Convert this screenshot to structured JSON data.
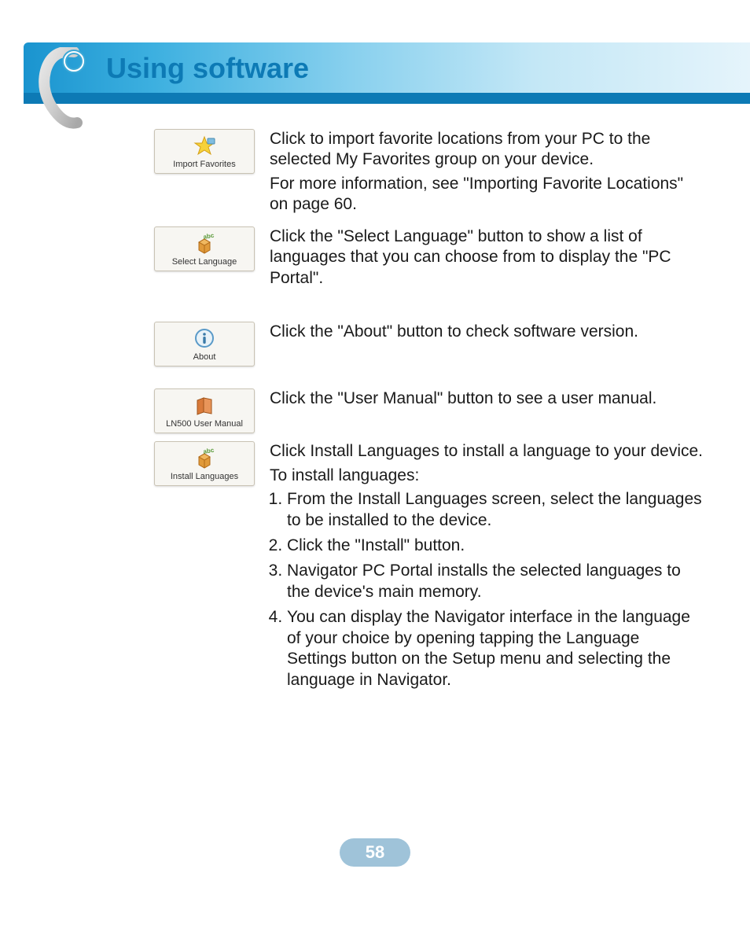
{
  "header": {
    "title": "Using software"
  },
  "buttons": {
    "import_favorites": "Import Favorites",
    "select_language": "Select Language",
    "about": "About",
    "user_manual": "LN500 User Manual",
    "install_languages": "Install Languages"
  },
  "descriptions": {
    "import_favorites_p1": "Click to import favorite locations from your PC to the selected My Favorites group on your device.",
    "import_favorites_p2": "For more information, see \"Importing Favorite Locations\" on page 60.",
    "select_language": "Click the \"Select Language\" button to show a list of languages that you can choose from to display the \"PC Portal\".",
    "about": "Click the \"About\" button to check software version.",
    "user_manual": "Click the \"User Manual\" button to see a user manual.",
    "install_languages_p1": "Click Install Languages to install a language to your device.",
    "install_languages_p2": "To install languages:",
    "install_steps": [
      "From the Install Languages screen, select the languages to be installed to the device.",
      "Click the \"Install\" button.",
      "Navigator PC Portal installs the selected languages to the device's main memory.",
      "You can display the Navigator interface in the language of your choice by opening tapping the Language Settings button on the Setup menu and selecting the language in Navigator."
    ]
  },
  "page_number": "58"
}
